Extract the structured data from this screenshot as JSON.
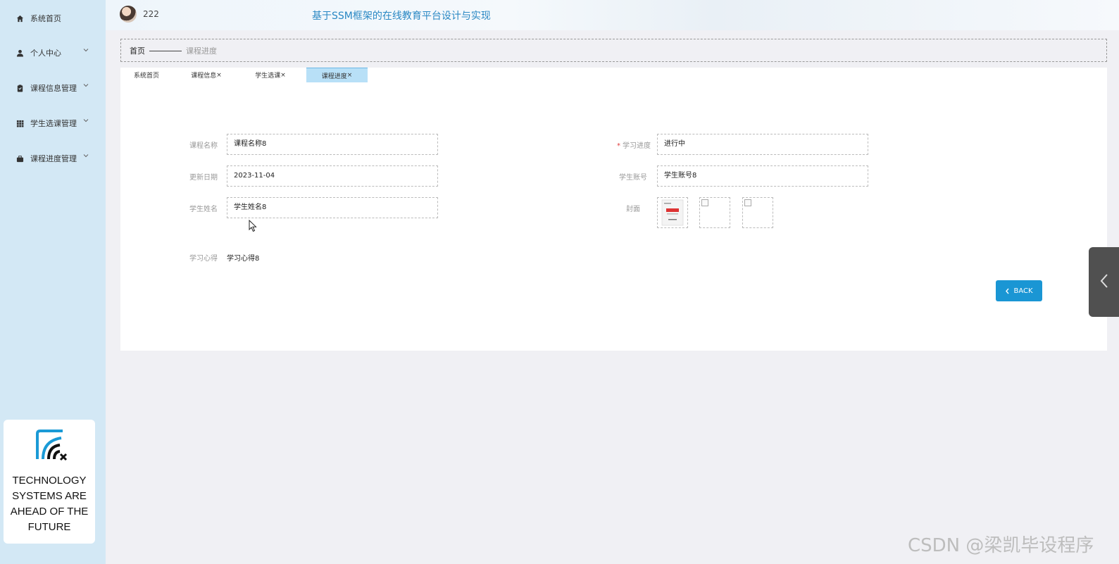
{
  "sidebar": {
    "items": [
      {
        "label": "系统首页",
        "icon": "home-icon"
      },
      {
        "label": "个人中心",
        "icon": "user-icon"
      },
      {
        "label": "课程信息管理",
        "icon": "clipboard-icon"
      },
      {
        "label": "学生选课管理",
        "icon": "grid-icon"
      },
      {
        "label": "课程进度管理",
        "icon": "briefcase-icon"
      }
    ],
    "logo_text": "TECHNOLOGY\nSYSTEMS   ARE\nAHEAD OF THE\nFUTURE"
  },
  "header": {
    "username": "222",
    "title": "基于SSM框架的在线教育平台设计与实现"
  },
  "breadcrumb": {
    "home": "首页",
    "current": "课程进度"
  },
  "tabs": [
    {
      "label": "系统首页",
      "closable": false,
      "active": false
    },
    {
      "label": "课程信息",
      "closable": true,
      "active": false
    },
    {
      "label": "学生选课",
      "closable": true,
      "active": false
    },
    {
      "label": "课程进度",
      "closable": true,
      "active": true
    }
  ],
  "tab_close_glyph": "×",
  "form": {
    "course_name": {
      "label": "课程名称",
      "value": "课程名称8"
    },
    "progress": {
      "label": "学习进度",
      "value": "进行中",
      "required": true
    },
    "update_date": {
      "label": "更新日期",
      "value": "2023-11-04"
    },
    "student_account": {
      "label": "学生账号",
      "value": "学生账号8"
    },
    "student_name": {
      "label": "学生姓名",
      "value": "学生姓名8"
    },
    "cover": {
      "label": "封面"
    },
    "experience": {
      "label": "学习心得",
      "value": "学习心得8"
    }
  },
  "required_mark": "*",
  "back_button": "BACK",
  "watermark": "CSDN @梁凯毕设程序",
  "colors": {
    "sidebar_bg": "#d3e8f5",
    "accent": "#1a96d4",
    "title": "#2a88c4",
    "active_tab": "#b8e0f7"
  }
}
